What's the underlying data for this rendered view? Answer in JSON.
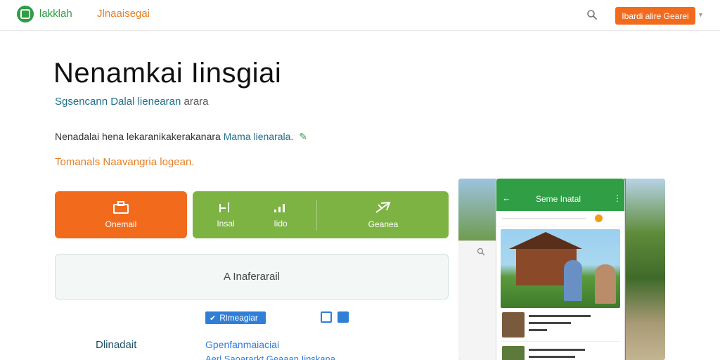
{
  "header": {
    "brand": "lakklah",
    "nav_link": "Jlnaaisegai",
    "cta_label": "Ibardi alire Gearei",
    "accent": "#2f9e44",
    "cta_color": "#f26b1d",
    "icons": {
      "logo": "logo-icon",
      "search": "search-icon",
      "caret": "chevron-down-icon"
    }
  },
  "hero": {
    "title": "Nenamkai Iinsgiai",
    "subtitle": "Sgsencann Dalal",
    "subtitle_mid": "lienearan",
    "subtitle_end": "arara",
    "description": "Nenadalai hena lekaranikakerakanara",
    "description_hl": "Mama lienarala.",
    "tagline": "Tomanals Naavangria logean."
  },
  "actions": [
    {
      "label": "Onemail",
      "icon": "briefcase-icon"
    },
    {
      "label": "Insal",
      "icon": "chart-icon"
    },
    {
      "label": "Iido",
      "icon": "signal-icon"
    },
    {
      "label": "Geanea",
      "icon": "send-icon"
    }
  ],
  "text_area": {
    "placeholder": "A Inaferarail"
  },
  "bottom": {
    "chip_label": "Rlmeagiar",
    "label": "Dlinadait",
    "link": "Gpenfanmaiaciai",
    "link2": "Aerl Saoararkt Geaaan Iinskana",
    "icons": {
      "edit": "edit-icon",
      "doc": "document-icon"
    }
  },
  "preview": {
    "app_title": "Seme Inatal",
    "icons": {
      "back": "back-arrow-icon",
      "menu": "more-vertical-icon",
      "search": "search-icon"
    }
  }
}
